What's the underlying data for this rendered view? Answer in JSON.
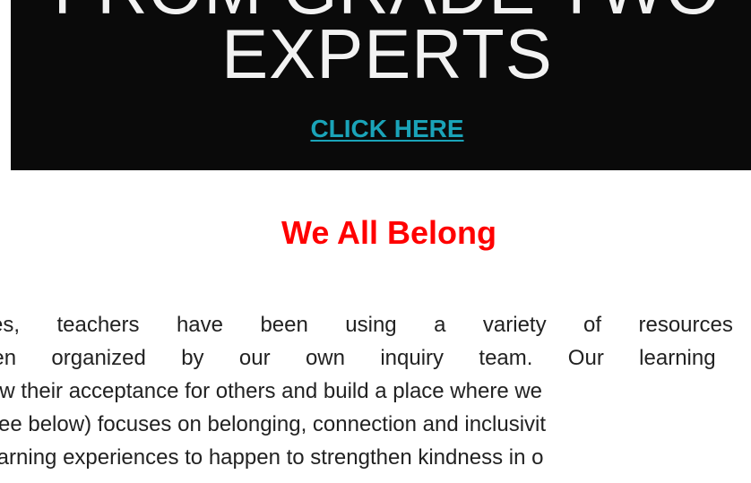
{
  "banner": {
    "line1": "FROM GRADE TWO",
    "line2": "EXPERTS",
    "cta_label": "CLICK HERE"
  },
  "section": {
    "heading": "We All Belong",
    "lines": [
      "ses, teachers have been using a variety of resources in",
      "een organized by our own inquiry team.  Our learning goa",
      "row their acceptance for others and build a place where we",
      "(see below) focuses on belonging, connection and inclusivit",
      "learning experiences to happen to strengthen kindness in o"
    ]
  },
  "colors": {
    "banner_bg": "#0a0a0a",
    "cta_link": "#1aa3b8",
    "heading": "#ff0000",
    "body_text": "#222222"
  }
}
